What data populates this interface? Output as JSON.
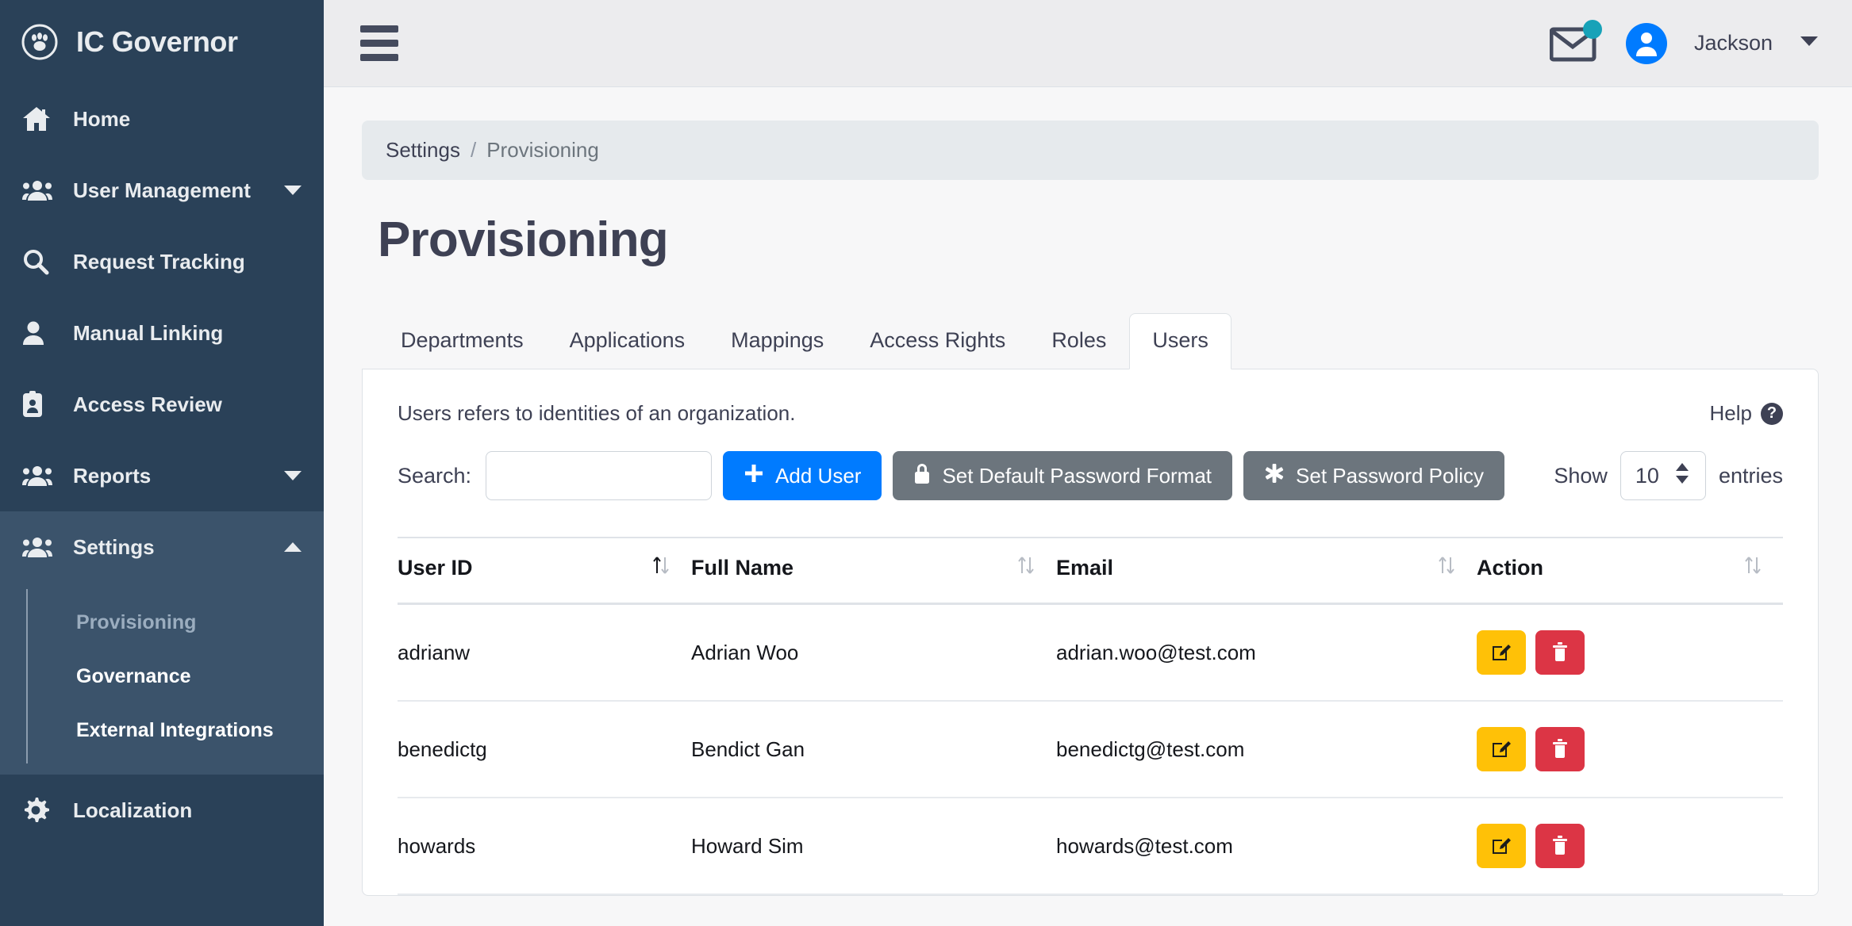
{
  "brand": {
    "title": "IC Governor",
    "logo_icon": "paw-circle-icon"
  },
  "sidebar": {
    "items": [
      {
        "label": "Home",
        "icon": "home-icon",
        "caret": "",
        "active": false
      },
      {
        "label": "User Management",
        "icon": "users-group-icon",
        "caret": "down",
        "active": false
      },
      {
        "label": "Request Tracking",
        "icon": "search-icon",
        "caret": "",
        "active": false
      },
      {
        "label": "Manual Linking",
        "icon": "person-icon",
        "caret": "",
        "active": false
      },
      {
        "label": "Access Review",
        "icon": "id-badge-icon",
        "caret": "",
        "active": false
      },
      {
        "label": "Reports",
        "icon": "users-group-icon",
        "caret": "down",
        "active": false
      },
      {
        "label": "Settings",
        "icon": "users-group-icon",
        "caret": "up",
        "active": true
      }
    ],
    "submenu": [
      {
        "label": "Provisioning",
        "current": true
      },
      {
        "label": "Governance",
        "current": false
      },
      {
        "label": "External Integrations",
        "current": false
      }
    ],
    "bottom_item": {
      "label": "Localization",
      "icon": "gear-icon"
    }
  },
  "topbar": {
    "menu_icon": "hamburger-icon",
    "mail_icon": "envelope-icon",
    "notification_dot_color": "#17a2b8",
    "avatar_icon": "user-avatar-icon",
    "avatar_color": "#007bff",
    "user_name": "Jackson",
    "caret_icon": "chevron-down-icon"
  },
  "breadcrumb": {
    "parent": "Settings",
    "separator": "/",
    "current": "Provisioning"
  },
  "page": {
    "title": "Provisioning"
  },
  "tabs": [
    {
      "label": "Departments",
      "active": false
    },
    {
      "label": "Applications",
      "active": false
    },
    {
      "label": "Mappings",
      "active": false
    },
    {
      "label": "Access Rights",
      "active": false
    },
    {
      "label": "Roles",
      "active": false
    },
    {
      "label": "Users",
      "active": true
    }
  ],
  "panel": {
    "description": "Users refers to identities of an organization.",
    "help_label": "Help",
    "help_icon": "question-circle-icon",
    "search_label": "Search:",
    "search_value": "",
    "search_placeholder": "",
    "buttons": [
      {
        "label": "Add User",
        "icon": "plus-icon",
        "style": "primary",
        "color": "#007bff"
      },
      {
        "label": "Set Default Password Format",
        "icon": "lock-icon",
        "style": "secondary",
        "color": "#6c757d"
      },
      {
        "label": "Set Password Policy",
        "icon": "asterisk-icon",
        "style": "secondary",
        "color": "#6c757d"
      }
    ],
    "show_label": "Show",
    "entries_value": "10",
    "entries_label": "entries",
    "stepper_icon": "updown-stepper-icon"
  },
  "table": {
    "sort_icon": "sort-updown-icon",
    "columns": [
      "User ID",
      "Full Name",
      "Email",
      "Action"
    ],
    "rows": [
      {
        "user_id": "adrianw",
        "full_name": "Adrian Woo",
        "email": "adrian.woo@test.com"
      },
      {
        "user_id": "benedictg",
        "full_name": "Bendict Gan",
        "email": "benedictg@test.com"
      },
      {
        "user_id": "howards",
        "full_name": "Howard Sim",
        "email": "howards@test.com"
      }
    ],
    "row_actions": [
      {
        "name": "edit",
        "icon": "pencil-square-icon",
        "color": "#ffc107"
      },
      {
        "name": "delete",
        "icon": "trash-icon",
        "color": "#dc3545"
      }
    ]
  }
}
